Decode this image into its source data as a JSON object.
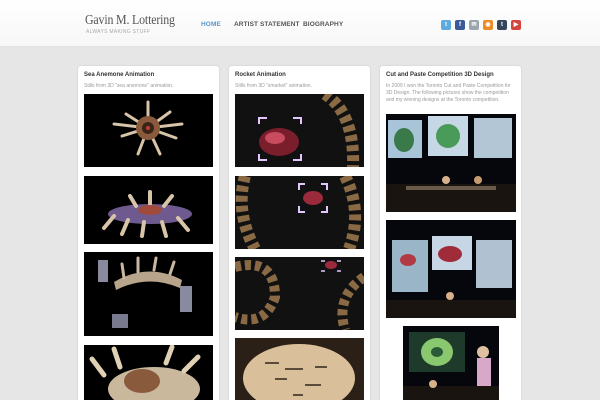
{
  "site": {
    "title": "Gavin M. Lottering",
    "tagline": "ALWAYS MAKING STUFF"
  },
  "nav": {
    "items": [
      {
        "label": "HOME",
        "active": true
      },
      {
        "label": "ARTIST STATEMENT",
        "active": false
      },
      {
        "label": "BIOGRAPHY",
        "active": false
      }
    ]
  },
  "social": [
    {
      "icon": "twitter-icon",
      "color": "#5ea9dd"
    },
    {
      "icon": "facebook-icon",
      "color": "#3b5998"
    },
    {
      "icon": "email-icon",
      "color": "#9aa5ad"
    },
    {
      "icon": "rss-icon",
      "color": "#f08a24"
    },
    {
      "icon": "tumblr-icon",
      "color": "#35465c"
    },
    {
      "icon": "youtube-icon",
      "color": "#d6453d"
    }
  ],
  "posts": [
    {
      "title": "Sea Anemone Animation",
      "description": "Stills from 3D \"sea anemone\" animation."
    },
    {
      "title": "Rocket Animation",
      "description": "Stills from 3D \"smarket\" animation."
    },
    {
      "title": "Cut and Paste Competition 3D Design",
      "description": "In 2009 I won the Toronto Cut and Paste Competition for 3D Design. The following pictures show the competition and my winning designs at the Toronto competition."
    }
  ],
  "colors": {
    "accent": "#5b95c8",
    "page_bg": "#e6e6e6"
  }
}
